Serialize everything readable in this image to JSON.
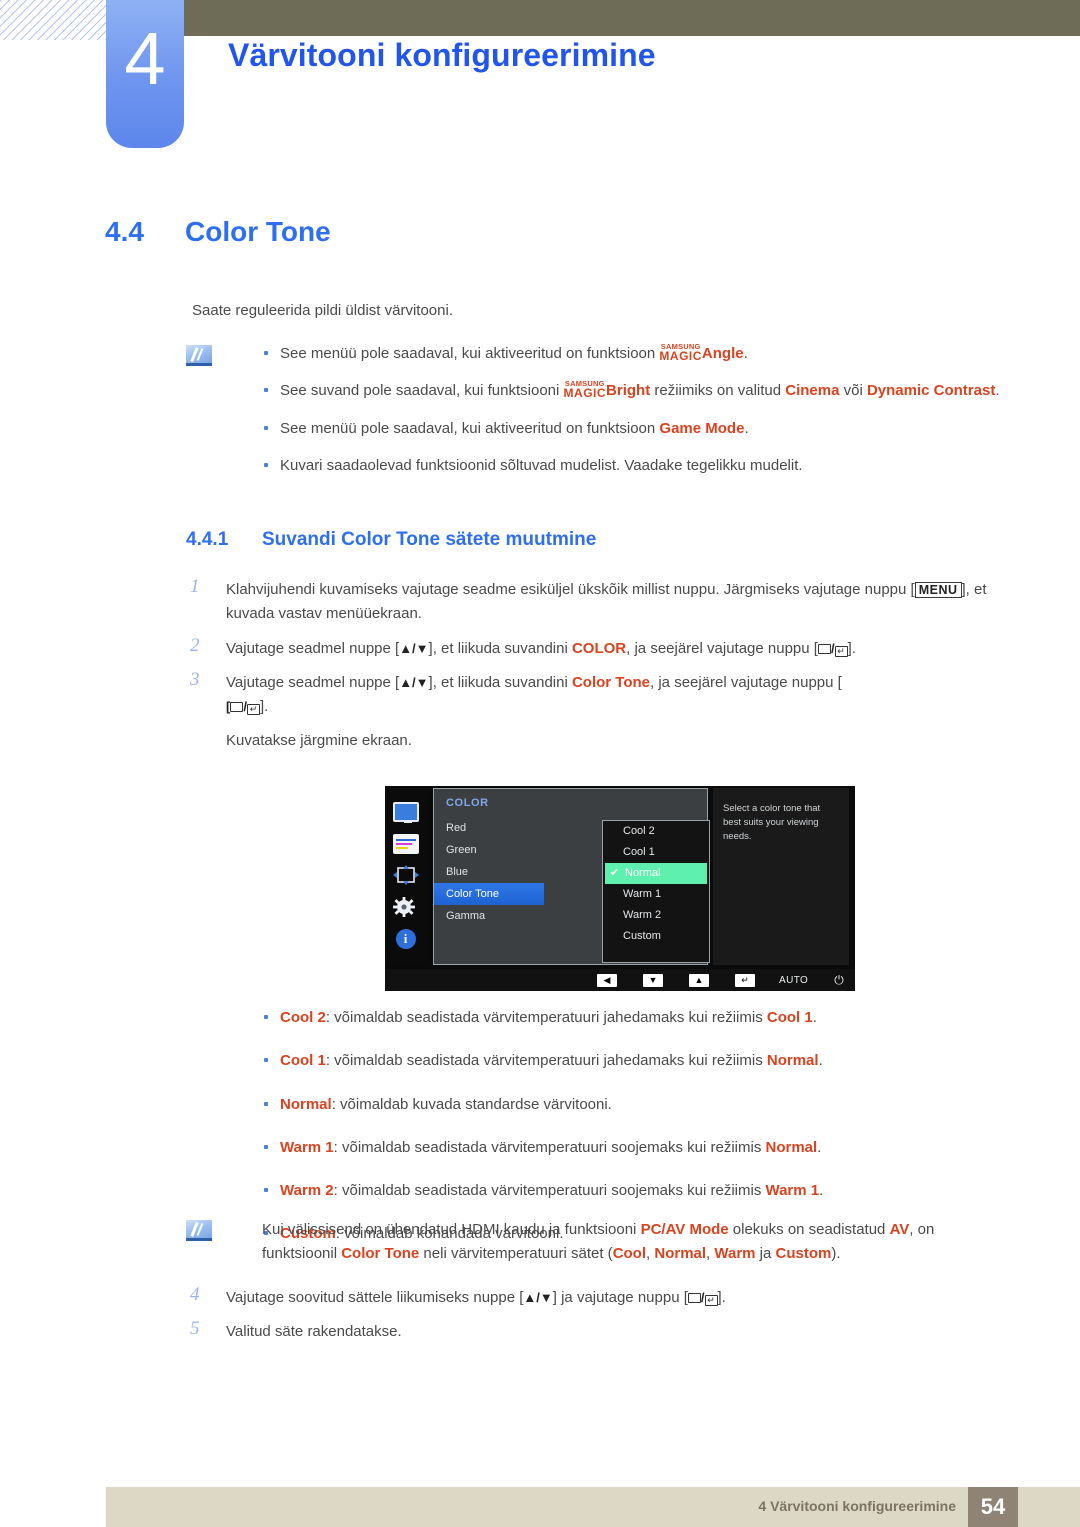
{
  "header": {
    "chapter_number": "4",
    "chapter_title": "Värvitooni konfigureerimine"
  },
  "section": {
    "number": "4.4",
    "title": "Color Tone",
    "intro": "Saate reguleerida pildi üldist värvitooni."
  },
  "note_top": {
    "icon": "note-pen-icon",
    "items": [
      {
        "pre": "See menüü pole saadaval, kui aktiveeritud on funktsioon ",
        "magic_small": "SAMSUNG",
        "magic_big": "MAGIC",
        "magic_suffix": "Angle",
        "post": "."
      },
      {
        "pre": "See suvand pole saadaval, kui funktsiooni ",
        "magic_small": "SAMSUNG",
        "magic_big": "MAGIC",
        "magic_suffix": "Bright",
        "mid": " režiimiks on valitud ",
        "hl1": "Cinema",
        "mid2": " või ",
        "hl2": "Dynamic Contrast",
        "post": "."
      },
      {
        "pre": "See menüü pole saadaval, kui aktiveeritud on funktsioon ",
        "hl1": "Game Mode",
        "post": "."
      },
      {
        "pre": "Kuvari saadaolevad funktsioonid sõltuvad mudelist. Vaadake tegelikku mudelit."
      }
    ]
  },
  "subsection": {
    "number": "4.4.1",
    "title": "Suvandi Color Tone sätete muutmine"
  },
  "steps": [
    {
      "n": "1",
      "a": "Klahvijuhendi kuvamiseks vajutage seadme esiküljel ükskõik millist nuppu. Järgmiseks vajutage nuppu [",
      "key": "MENU",
      "b": "], et kuvada vastav menüüekraan."
    },
    {
      "n": "2",
      "a": "Vajutage seadmel nuppe [",
      "arrows": "▲/▼",
      "b": "], et liikuda suvandini ",
      "hl": "COLOR",
      "c": ", ja seejärel vajutage nuppu [",
      "d": "]."
    },
    {
      "n": "3",
      "a": "Vajutage seadmel nuppe [",
      "arrows": "▲/▼",
      "b": "], et liikuda suvandini ",
      "hl": "Color Tone",
      "c": ", ja seejärel vajutage nuppu [",
      "d": "].",
      "extra": "Kuvatakse järgmine ekraan."
    }
  ],
  "steps_bottom": [
    {
      "n": "4",
      "a": "Vajutage soovitud sättele liikumiseks nuppe [",
      "arrows": "▲/▼",
      "b": "] ja vajutage nuppu [",
      "d": "]."
    },
    {
      "n": "5",
      "a": "Valitud säte rakendatakse."
    }
  ],
  "osd": {
    "menu_title": "COLOR",
    "menu_items": [
      {
        "label": "Red",
        "selected": false
      },
      {
        "label": "Green",
        "selected": false
      },
      {
        "label": "Blue",
        "selected": false
      },
      {
        "label": "Color Tone",
        "selected": true
      },
      {
        "label": "Gamma",
        "selected": false
      }
    ],
    "options": [
      {
        "label": "Cool 2",
        "checked": false
      },
      {
        "label": "Cool 1",
        "checked": false
      },
      {
        "label": "Normal",
        "checked": true
      },
      {
        "label": "Warm 1",
        "checked": false
      },
      {
        "label": "Warm 2",
        "checked": false
      },
      {
        "label": "Custom",
        "checked": false
      }
    ],
    "help_text": "Select a color tone that best suits your viewing needs.",
    "bottom_buttons": [
      "◀",
      "▼",
      "▲",
      "↵"
    ],
    "auto_label": "AUTO",
    "power_glyph": "⏻",
    "side_icons": [
      "monitor-icon",
      "sliders-icon",
      "navigation-icon",
      "gear-icon",
      "info-icon"
    ],
    "highlight_color": "#5df0ae",
    "selected_color": "#2e78e8"
  },
  "option_descriptions": [
    {
      "name": "Cool 2",
      "mid": ": võimaldab seadistada värvitemperatuuri jahedamaks kui režiimis ",
      "ref": "Cool 1",
      "end": "."
    },
    {
      "name": "Cool 1",
      "mid": ": võimaldab seadistada värvitemperatuuri jahedamaks kui režiimis ",
      "ref": "Normal",
      "end": "."
    },
    {
      "name": "Normal",
      "mid": ": võimaldab kuvada standardse värvitooni.",
      "ref": "",
      "end": ""
    },
    {
      "name": "Warm 1",
      "mid": ": võimaldab seadistada värvitemperatuuri soojemaks kui režiimis ",
      "ref": "Normal",
      "end": "."
    },
    {
      "name": "Warm 2",
      "mid": ": võimaldab seadistada värvitemperatuuri soojemaks kui režiimis ",
      "ref": "Warm 1",
      "end": "."
    },
    {
      "name": "Custom",
      "mid": ": võimaldab kohandada värvitooni.",
      "ref": "",
      "end": ""
    }
  ],
  "note_bottom": {
    "icon": "note-pen-icon",
    "a": "Kui välissisend on ühendatud HDMI kaudu ja funktsiooni ",
    "hl1": "PC/AV Mode",
    "b": " olekuks on seadistatud ",
    "hl2": "AV",
    "c": ", on funktsioonil ",
    "hl3": "Color Tone",
    "d": " neli värvitemperatuuri sätet (",
    "hl4": "Cool",
    "e": ", ",
    "hl5": "Normal",
    "f": ", ",
    "hl6": "Warm",
    "g": " ja ",
    "hl7": "Custom",
    "h": ")."
  },
  "footer": {
    "text": "4 Värvitooni konfigureerimine",
    "page": "54"
  }
}
